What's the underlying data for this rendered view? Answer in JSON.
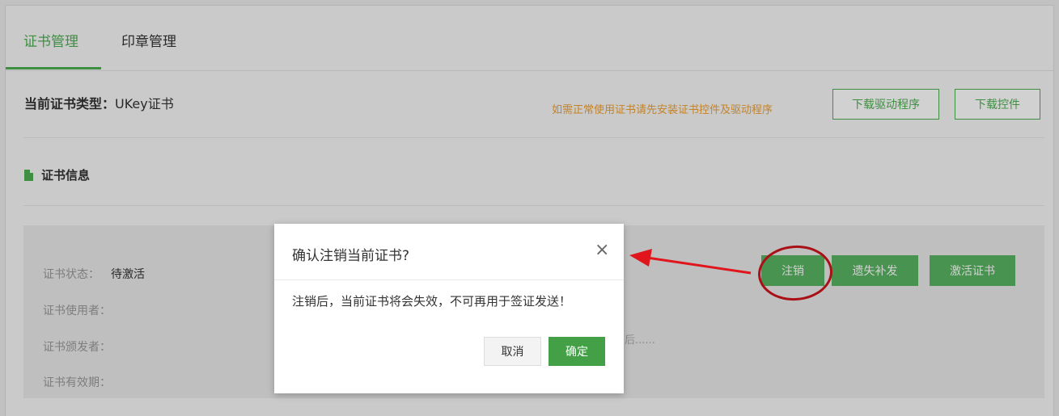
{
  "tabs": [
    {
      "label": "证书管理",
      "active": true
    },
    {
      "label": "印章管理",
      "active": false
    }
  ],
  "cert_type": {
    "label": "当前证书类型：",
    "value": "UKey证书"
  },
  "install_hint": "如需正常使用证书请先安装证书控件及驱动程序",
  "buttons": {
    "download_driver": "下载驱动程序",
    "download_control": "下载控件"
  },
  "section": {
    "title": "证书信息",
    "icon": "document-icon"
  },
  "info_rows": [
    {
      "label": "证书状态：",
      "value": "待激活"
    },
    {
      "label": "证书使用者：",
      "value": ""
    },
    {
      "label": "证书颁发者：",
      "value": ""
    },
    {
      "label": "证书有效期：",
      "value": ""
    }
  ],
  "obscured_text": "后......",
  "actions": {
    "cancel_cert": "注销",
    "reissue": "遗失补发",
    "activate": "激活证书"
  },
  "dialog": {
    "title": "确认注销当前证书?",
    "message": "注销后，当前证书将会失效，不可再用于签证发送！",
    "cancel_label": "取消",
    "confirm_label": "确定",
    "close_icon": "close-icon"
  },
  "colors": {
    "accent": "#4caf50",
    "hint": "#f0a030",
    "annotation": "#d0151b"
  }
}
